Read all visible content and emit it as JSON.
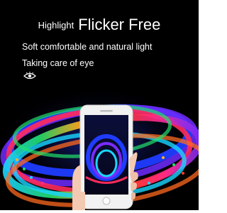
{
  "headline": {
    "small": "Highlight",
    "big": "Flicker Free"
  },
  "lines": {
    "first": "Soft comfortable and natural light",
    "second": "Taking care of eye"
  },
  "icons": {
    "eye": "eye-icon"
  },
  "colors": {
    "background": "#000000",
    "text": "#ffffff",
    "neon": [
      "#1f3cff",
      "#7a2bff",
      "#ff2b5a",
      "#19d6ff",
      "#22e06b",
      "#ffb21f",
      "#ff3b1f"
    ]
  }
}
